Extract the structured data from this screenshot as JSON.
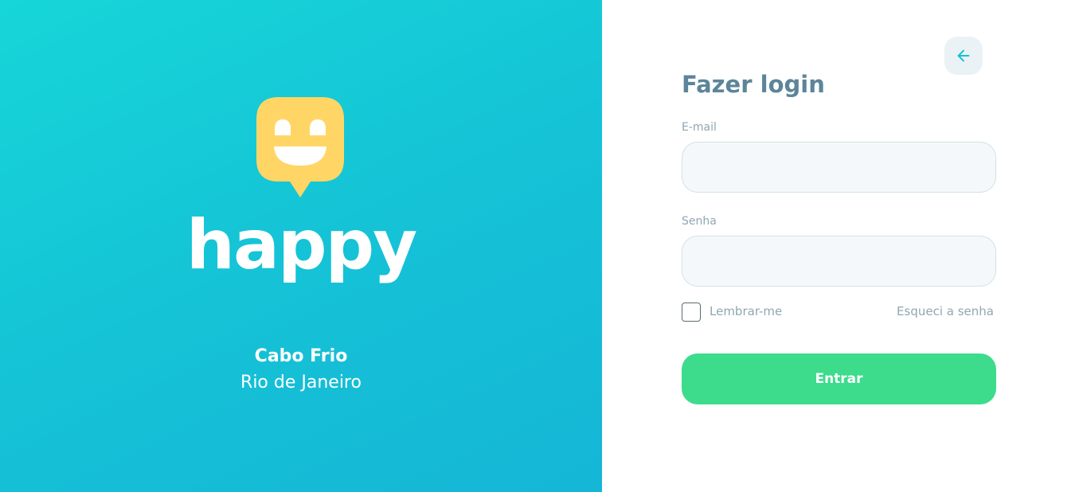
{
  "brand": {
    "name": "happy",
    "icon": "happy-face-logo",
    "colors": {
      "panel_start": "#16d6d8",
      "panel_end": "#15b6d6",
      "logo": "#ffd666"
    }
  },
  "location": {
    "city": "Cabo Frio",
    "state": "Rio de Janeiro"
  },
  "login": {
    "title": "Fazer login",
    "back_icon": "arrow-left-icon",
    "email": {
      "label": "E-mail",
      "value": "",
      "placeholder": ""
    },
    "password": {
      "label": "Senha",
      "value": "",
      "placeholder": ""
    },
    "remember": {
      "label": "Lembrar-me",
      "checked": false
    },
    "forgot_label": "Esqueci a senha",
    "submit_label": "Entrar",
    "colors": {
      "title": "#5c8599",
      "accent": "#15c3d6",
      "submit": "#3cdc8c"
    }
  }
}
